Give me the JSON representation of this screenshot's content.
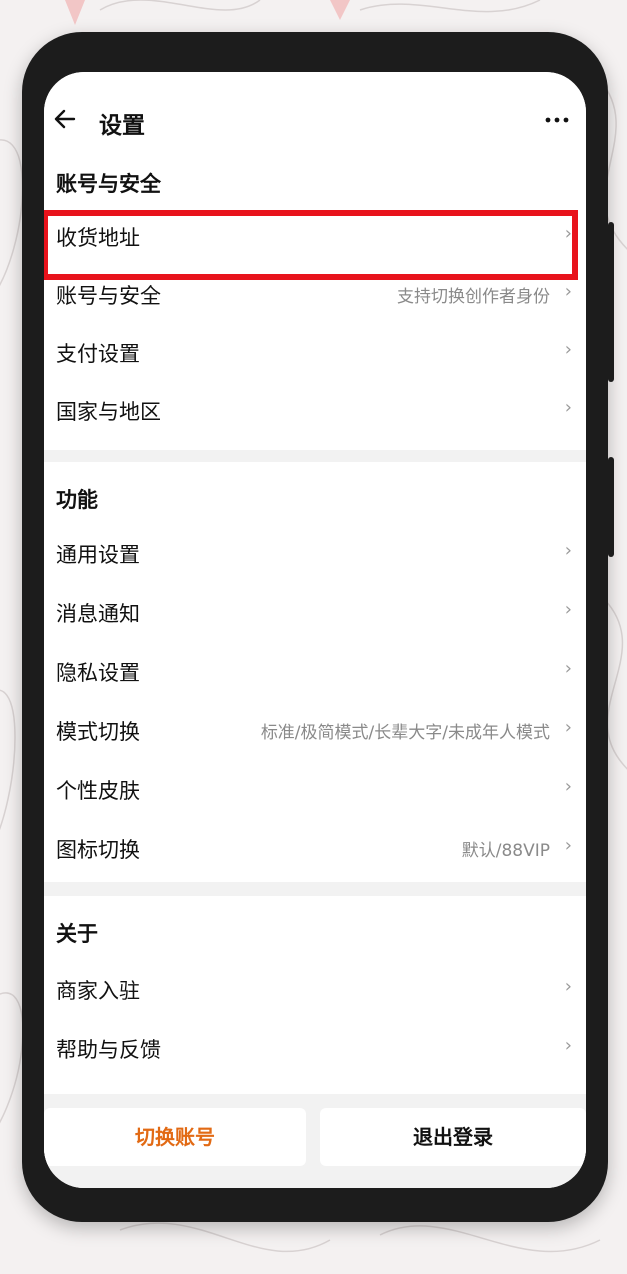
{
  "header": {
    "title": "设置",
    "back_icon": "arrow-left-icon",
    "more_icon": "more-dots-icon"
  },
  "section_account": {
    "heading": "账号与安全",
    "items": [
      {
        "label": "收货地址",
        "value": ""
      },
      {
        "label": "账号与安全",
        "value": "支持切换创作者身份"
      },
      {
        "label": "支付设置",
        "value": ""
      },
      {
        "label": "国家与地区",
        "value": ""
      }
    ]
  },
  "section_function": {
    "heading": "功能",
    "items": [
      {
        "label": "通用设置",
        "value": ""
      },
      {
        "label": "消息通知",
        "value": ""
      },
      {
        "label": "隐私设置",
        "value": ""
      },
      {
        "label": "模式切换",
        "value": "标准/极简模式/长辈大字/未成年人模式"
      },
      {
        "label": "个性皮肤",
        "value": ""
      },
      {
        "label": "图标切换",
        "value": "默认/88VIP"
      }
    ]
  },
  "section_about": {
    "heading": "关于",
    "items": [
      {
        "label": "商家入驻",
        "value": ""
      },
      {
        "label": "帮助与反馈",
        "value": ""
      }
    ]
  },
  "footer": {
    "switch_account": "切换账号",
    "logout": "退出登录"
  },
  "colors": {
    "accent": "#e26a14",
    "highlight": "#e8131c"
  }
}
